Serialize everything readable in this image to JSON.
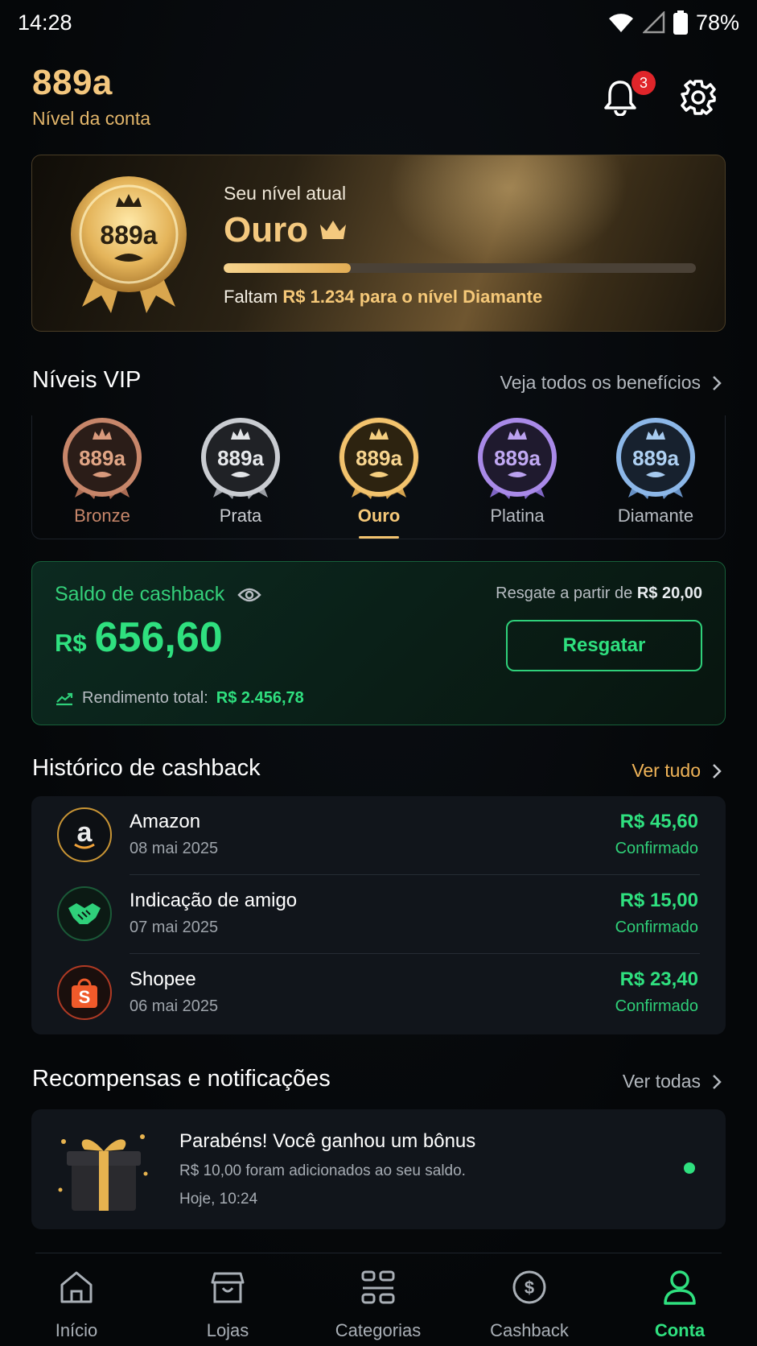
{
  "status_bar": {
    "time": "14:28",
    "battery": "78%"
  },
  "header": {
    "brand": "889a",
    "subtitle": "Nível da conta",
    "notification_count": "3"
  },
  "hero": {
    "label": "Seu nível atual",
    "level": "Ouro",
    "medal_text": "889a",
    "progress": 0.27,
    "text_prefix": "Faltam ",
    "text_highlight": "R$ 1.234 para o nível Diamante"
  },
  "vip": {
    "title": "Níveis VIP",
    "link": "Veja todos os benefícios",
    "levels": [
      {
        "label": "Bronze",
        "medal": "889a",
        "color": "#c7866a"
      },
      {
        "label": "Prata",
        "medal": "889a",
        "color": "#c9ccd1"
      },
      {
        "label": "Ouro",
        "medal": "889a",
        "color": "#f3c36d",
        "selected": true
      },
      {
        "label": "Platina",
        "medal": "889a",
        "color": "#a98ae8"
      },
      {
        "label": "Diamante",
        "medal": "889a",
        "color": "#8cb7e8"
      }
    ]
  },
  "balance": {
    "label": "Saldo de cashback",
    "currency": "R$",
    "value": "656,60",
    "min_prefix": "Resgate a partir de ",
    "min_value": "R$ 20,00",
    "redeem_label": "Resgatar",
    "yield_prefix": "Rendimento total: ",
    "yield_value": "R$ 2.456,78"
  },
  "history": {
    "title": "Histórico de cashback",
    "link": "Ver tudo",
    "items": [
      {
        "name": "Amazon",
        "date": "08 mai 2025",
        "amount": "R$ 45,60",
        "status": "Confirmado",
        "icon": "amazon-icon"
      },
      {
        "name": "Indicação de amigo",
        "date": "07 mai 2025",
        "amount": "R$ 15,00",
        "status": "Confirmado",
        "icon": "handshake-icon"
      },
      {
        "name": "Shopee",
        "date": "06 mai 2025",
        "amount": "R$ 23,40",
        "status": "Confirmado",
        "icon": "shopee-icon"
      }
    ]
  },
  "rewards": {
    "title": "Recompensas e notificações",
    "link": "Ver todas",
    "item": {
      "title": "Parabéns! Você ganhou um bônus",
      "desc": "R$ 10,00 foram adicionados ao seu saldo.",
      "time": "Hoje, 10:24"
    }
  },
  "nav": {
    "items": [
      {
        "label": "Início",
        "icon": "home-icon"
      },
      {
        "label": "Lojas",
        "icon": "store-icon"
      },
      {
        "label": "Categorias",
        "icon": "categories-icon"
      },
      {
        "label": "Cashback",
        "icon": "dollar-icon"
      },
      {
        "label": "Conta",
        "icon": "user-icon",
        "active": true
      }
    ]
  },
  "colors": {
    "accent_green": "#2fe07f",
    "gold": "#f4c77e",
    "background": "#050709"
  }
}
